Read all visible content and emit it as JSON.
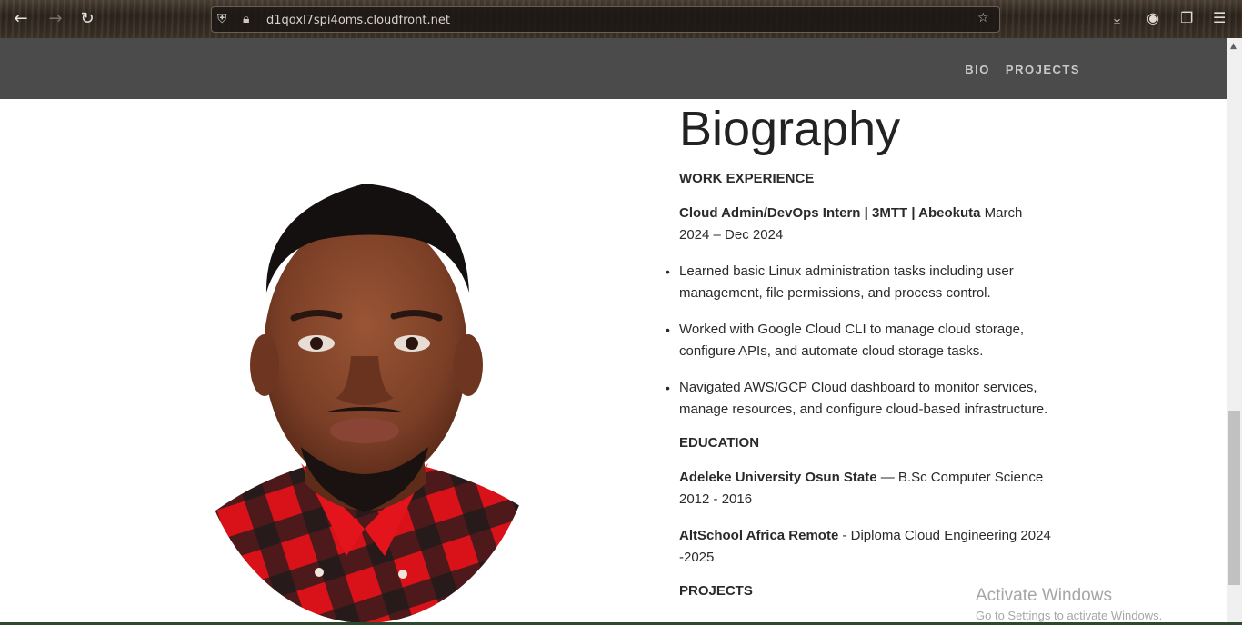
{
  "browser": {
    "url": "d1qoxl7spi4oms.cloudfront.net"
  },
  "nav": {
    "items": [
      "BIO",
      "PROJECTS"
    ]
  },
  "bio": {
    "title": "Biography",
    "work_heading": "WORK EXPERIENCE",
    "job_title": "Cloud Admin/DevOps Intern | 3MTT | Abeokuta",
    "job_dates": "March 2024 – Dec 2024",
    "bullets": [
      "Learned basic Linux administration tasks including user management, file permissions, and process control.",
      "Worked with Google Cloud CLI to manage cloud storage, configure APIs, and automate cloud storage tasks.",
      "Navigated AWS/GCP Cloud dashboard to monitor services, manage resources, and configure cloud-based infrastructure."
    ],
    "education_heading": "EDUCATION",
    "edu1_school": "Adeleke University Osun State",
    "edu1_detail": "— B.Sc Computer Science 2012 - 2016",
    "edu2_school": "AltSchool Africa Remote",
    "edu2_detail": "- Diploma Cloud Engineering 2024 -2025",
    "projects_heading": "PROJECTS"
  },
  "watermark": {
    "line1": "Activate Windows",
    "line2": "Go to Settings to activate Windows."
  },
  "colors": {
    "navbar": "#4b4b4b",
    "shirt_red": "#e0121b",
    "skin": "#7a3e26"
  }
}
